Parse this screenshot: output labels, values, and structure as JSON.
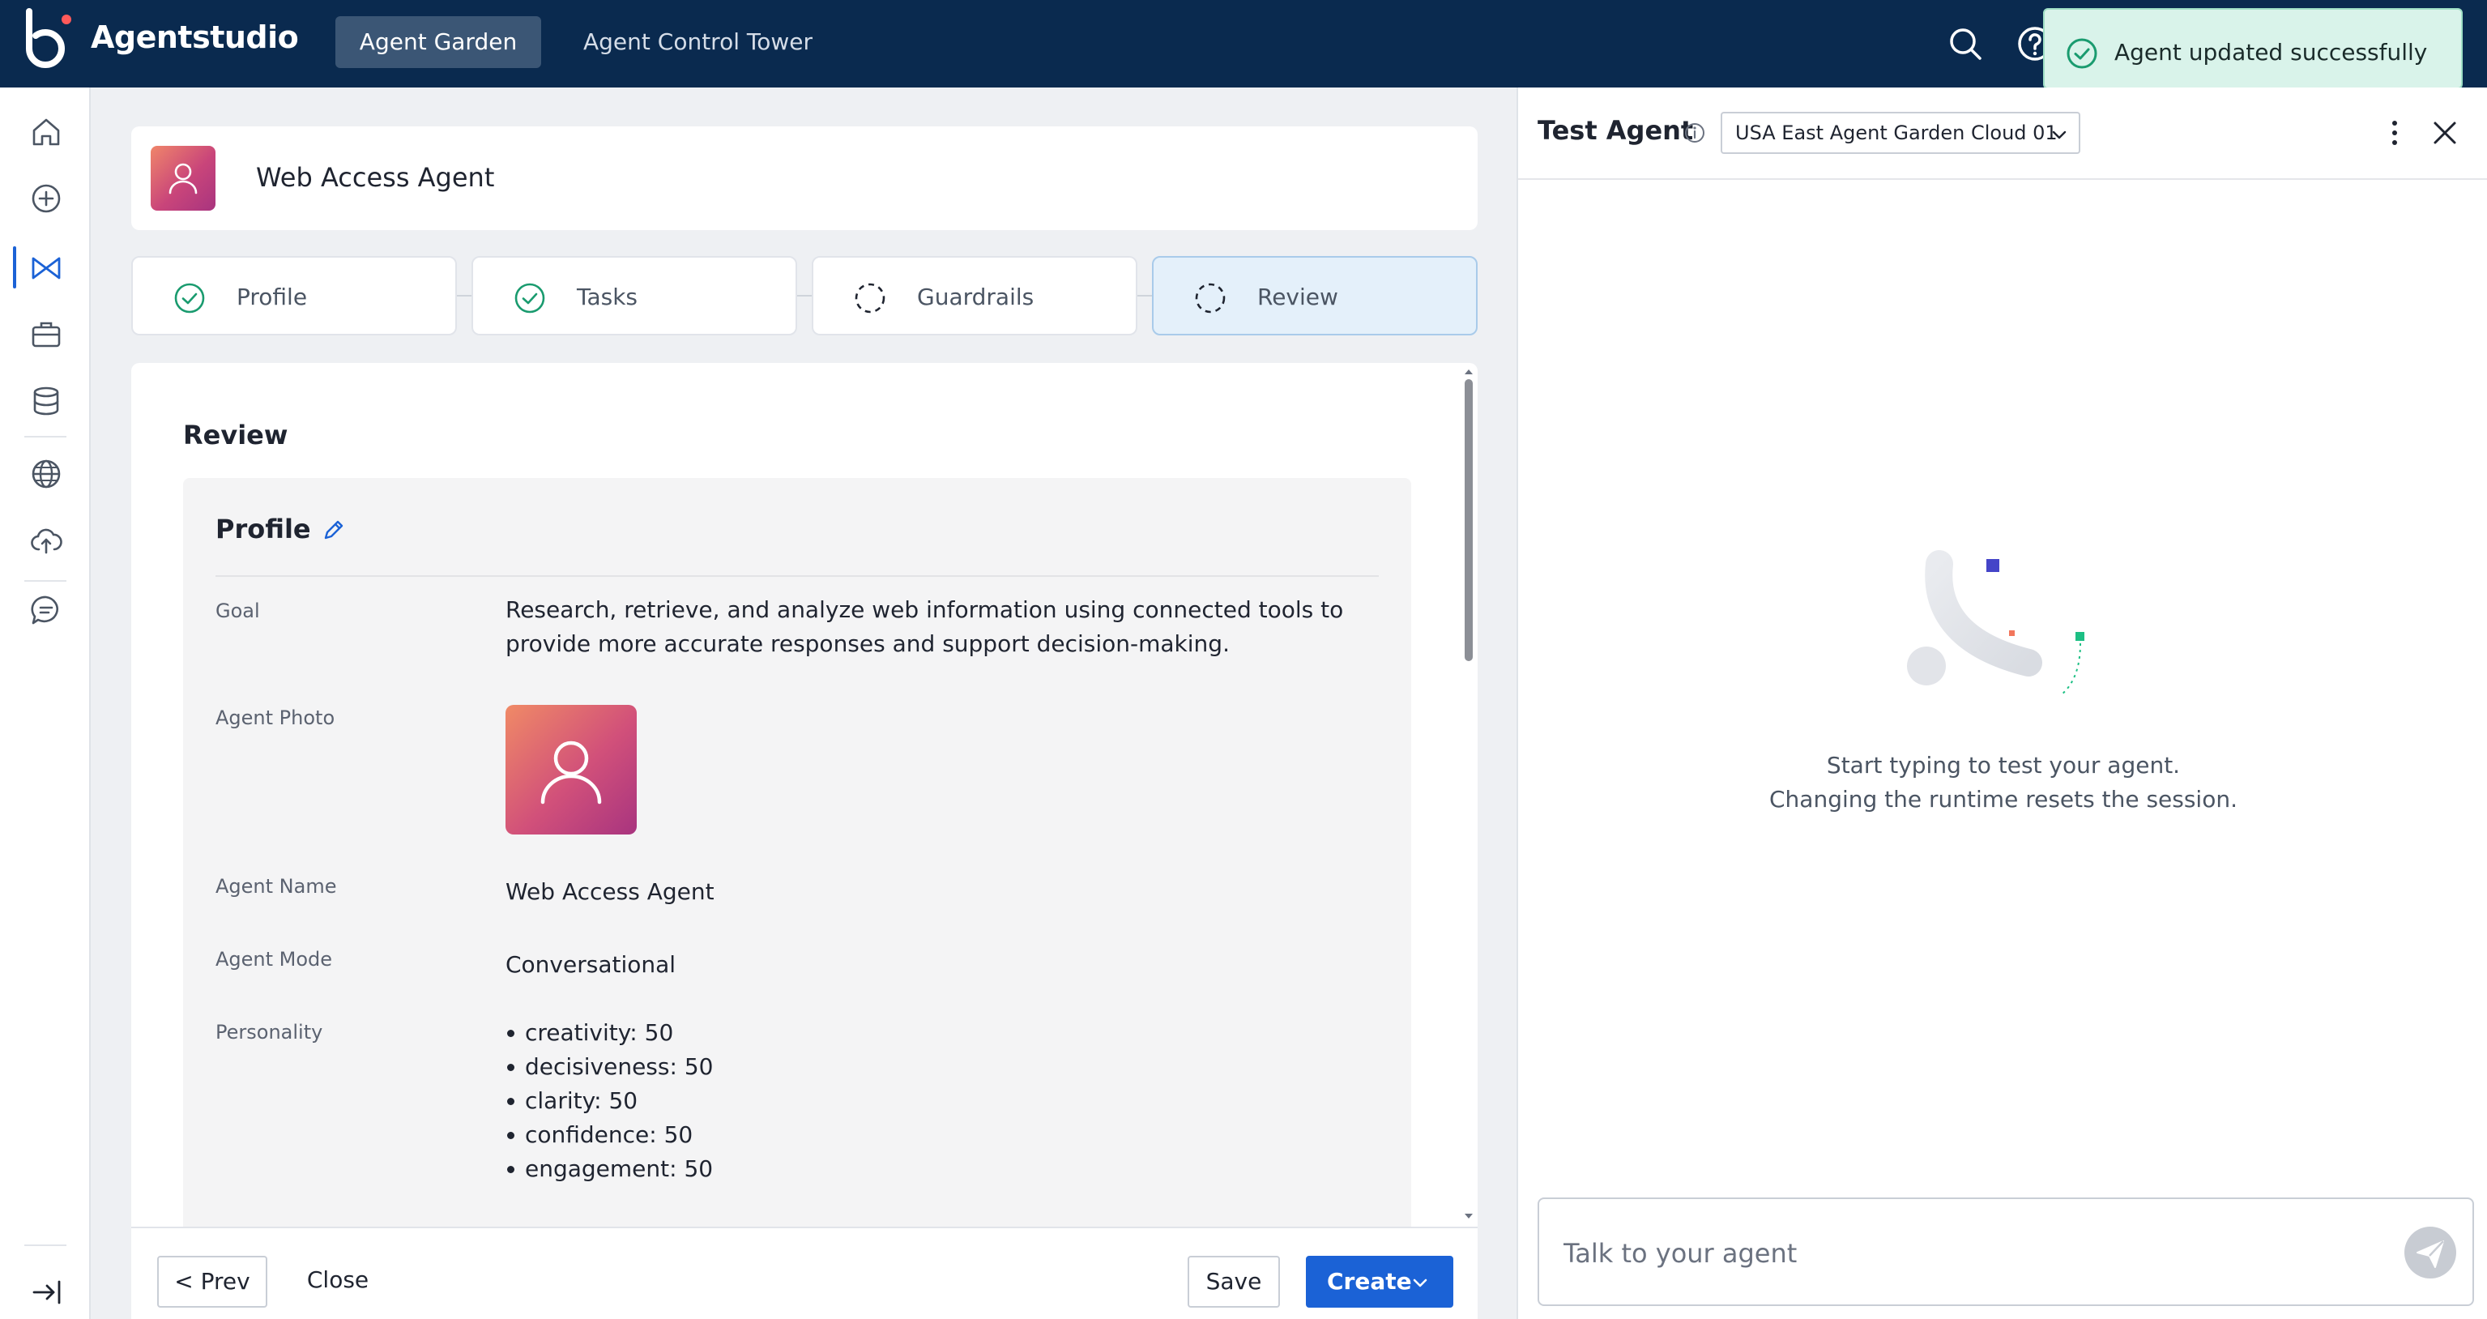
{
  "app": {
    "brand": "Agentstudio",
    "nav_tabs": [
      {
        "label": "Agent Garden",
        "active": true
      },
      {
        "label": "Agent Control Tower",
        "active": false
      }
    ],
    "toast": "Agent updated successfully",
    "colors": {
      "nav_bg": "#0a2a4f",
      "primary": "#1b62d6",
      "success": "#1a9b6f",
      "toast_bg": "#d9f3ea"
    }
  },
  "sidebar": {
    "icons": [
      "home-icon",
      "add-circle-icon",
      "agent-garden-icon",
      "briefcase-icon",
      "database-icon",
      "globe-icon",
      "cloud-upload-icon",
      "chat-bubble-icon",
      "collapse-sidebar-icon"
    ],
    "active_index": 2
  },
  "agent": {
    "name": "Web Access Agent"
  },
  "steps": [
    {
      "label": "Profile",
      "status": "complete"
    },
    {
      "label": "Tasks",
      "status": "complete"
    },
    {
      "label": "Guardrails",
      "status": "pending"
    },
    {
      "label": "Review",
      "status": "active"
    }
  ],
  "review": {
    "title": "Review",
    "profile": {
      "heading": "Profile",
      "goal_label": "Goal",
      "goal_value": "Research, retrieve, and analyze web information using connected tools to provide more accurate responses and support decision-making.",
      "photo_label": "Agent Photo",
      "name_label": "Agent Name",
      "name_value": "Web Access Agent",
      "mode_label": "Agent Mode",
      "mode_value": "Conversational",
      "personality_label": "Personality",
      "personality": [
        "creativity: 50",
        "decisiveness: 50",
        "clarity: 50",
        "confidence: 50",
        "engagement: 50"
      ]
    }
  },
  "footer": {
    "prev_label": "< Prev",
    "close_label": "Close",
    "save_label": "Save",
    "create_label": "Create"
  },
  "test_panel": {
    "title": "Test Agent",
    "runtime": "USA East Agent Garden Cloud 01",
    "empty_line1": "Start typing to test your agent.",
    "empty_line2": "Changing the runtime resets the session.",
    "chat_placeholder": "Talk to your agent"
  }
}
